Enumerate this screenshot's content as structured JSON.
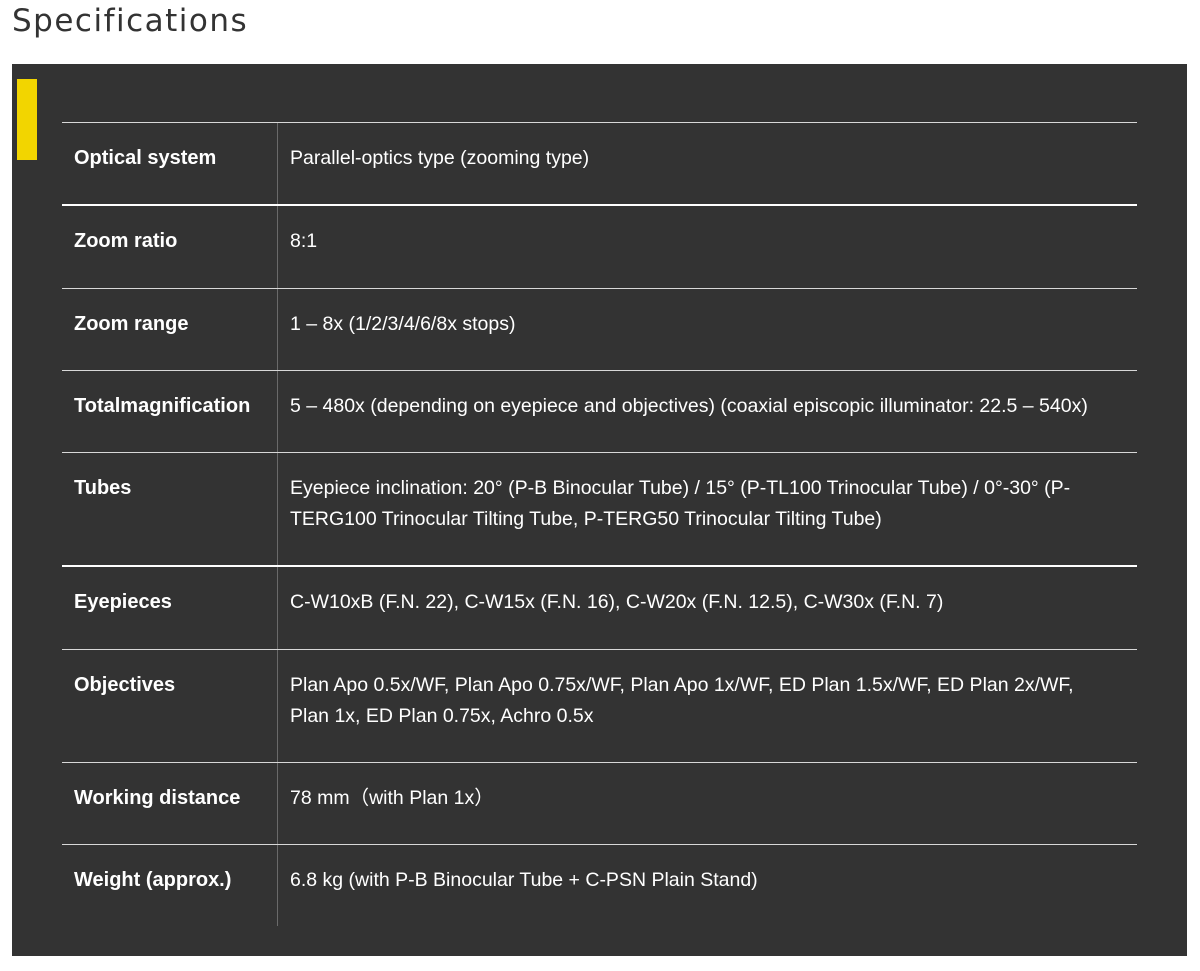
{
  "title": "Specifications",
  "colors": {
    "panel_background": "#333333",
    "accent": "#f2d500",
    "text": "#ffffff",
    "title_text": "#333333"
  },
  "specs": [
    {
      "label": "Optical system",
      "value": "Parallel-optics type (zooming type)"
    },
    {
      "label": "Zoom ratio",
      "value": "8:1"
    },
    {
      "label": "Zoom range",
      "value": "1 – 8x (1/2/3/4/6/8x stops)"
    },
    {
      "label": "Totalmagnification",
      "value": "5 – 480x (depending on eyepiece and objectives) (coaxial episcopic illuminator: 22.5 – 540x)"
    },
    {
      "label": "Tubes",
      "value": "Eyepiece inclination: 20° (P-B Binocular Tube) / 15° (P-TL100 Trinocular Tube) / 0°-30° (P-TERG100 Trinocular Tilting Tube, P-TERG50 Trinocular Tilting Tube)"
    },
    {
      "label": "Eyepieces",
      "value": "C-W10xB (F.N. 22), C-W15x (F.N. 16), C-W20x (F.N. 12.5), C-W30x (F.N. 7)"
    },
    {
      "label": "Objectives",
      "value": "Plan Apo 0.5x/WF, Plan Apo 0.75x/WF, Plan Apo 1x/WF, ED Plan 1.5x/WF, ED Plan 2x/WF, Plan 1x, ED Plan 0.75x, Achro 0.5x"
    },
    {
      "label": "Working distance",
      "value": "78 mm（with Plan 1x）"
    },
    {
      "label": "Weight (approx.)",
      "value": "6.8 kg (with P-B Binocular Tube + C-PSN Plain Stand)"
    }
  ]
}
